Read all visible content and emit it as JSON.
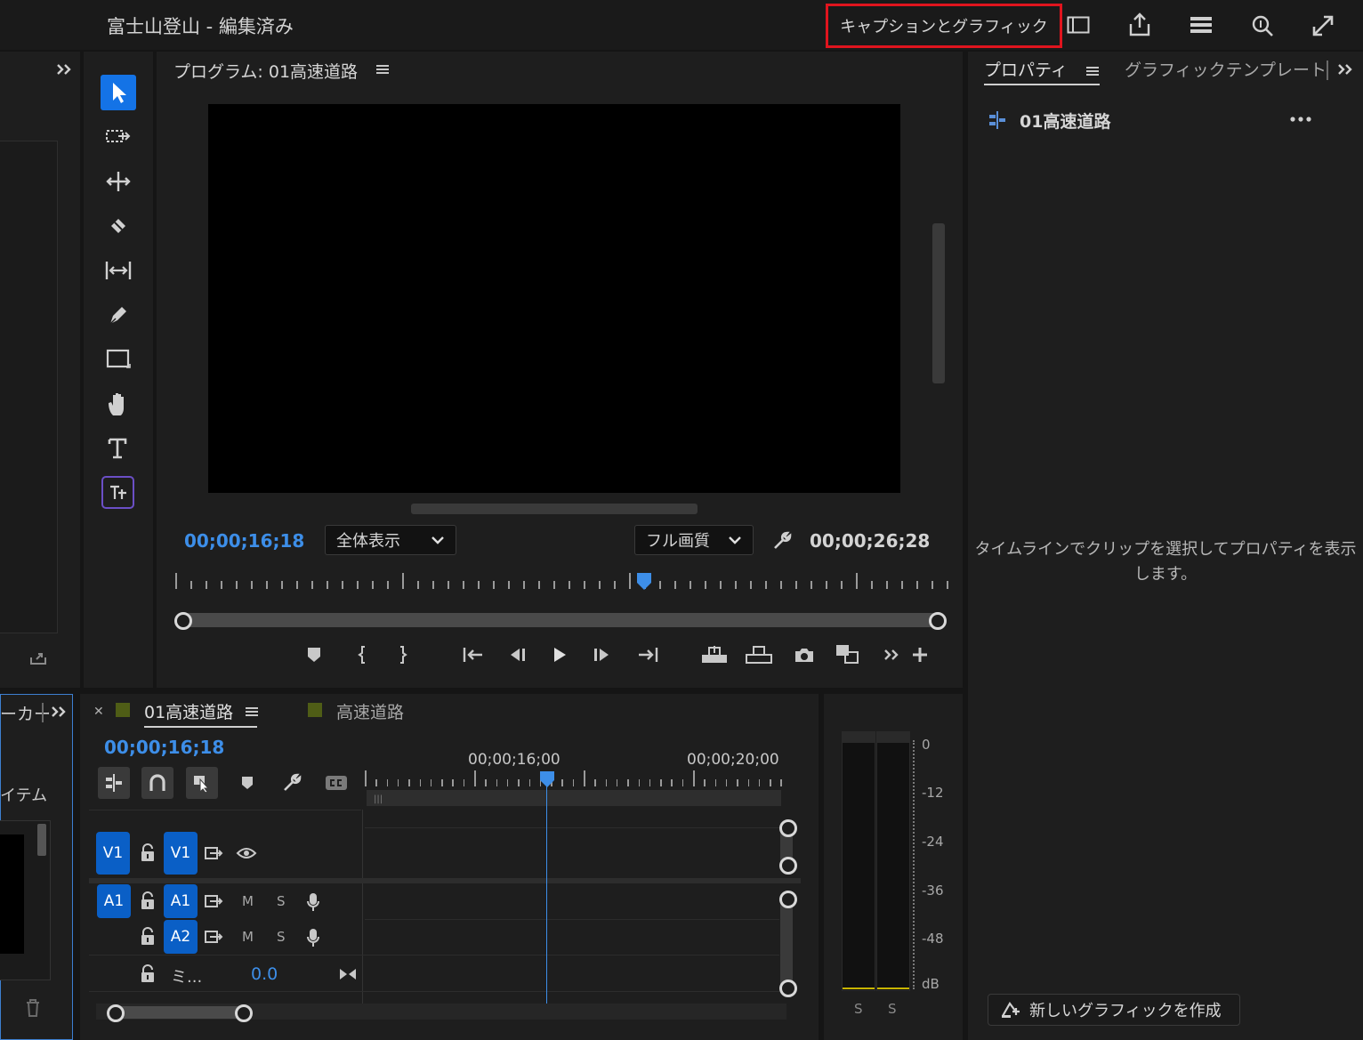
{
  "app": {
    "project_title": "富士山登山 - 編集済み",
    "workspace_label": "キャプションとグラフィック"
  },
  "program_monitor": {
    "title": "プログラム: 01高速道路",
    "timecode_current": "00;00;16;18",
    "timecode_duration": "00;00;26;28",
    "zoom_value": "全体表示",
    "quality_value": "フル画質"
  },
  "properties_panel": {
    "tab_properties": "プロパティ",
    "tab_graphic_templates": "グラフィックテンプレート",
    "sequence_name": "01高速道路",
    "empty_message": "タイムラインでクリップを選択してプロパティを表示します。",
    "new_graphic_button": "新しいグラフィックを作成"
  },
  "left_bottom_panel": {
    "tab_partial": "ーカー",
    "item_partial": "イテム"
  },
  "timeline": {
    "tab_active": "01高速道路",
    "tab_other": "高速道路",
    "timecode": "00;00;16;18",
    "ruler_labels": [
      "00;00;16;00",
      "00;00;20;00"
    ],
    "tracks": {
      "v1_source": "V1",
      "v1_target": "V1",
      "a1_source": "A1",
      "a1_target": "A1",
      "a2_target": "A2",
      "mute": "M",
      "solo": "S",
      "mix_label": "ミ...",
      "mix_value": "0.0"
    }
  },
  "audio_meter": {
    "scale": [
      "0",
      "-12",
      "-24",
      "-36",
      "-48",
      "dB"
    ],
    "solo_left": "S",
    "solo_right": "S"
  },
  "colors": {
    "accent_blue": "#3d8ee8",
    "track_blue": "#0a5fc6",
    "highlight_red": "#e0141e",
    "panel_bg": "#1e1e1e",
    "sequence_green": "#4f5d16"
  }
}
